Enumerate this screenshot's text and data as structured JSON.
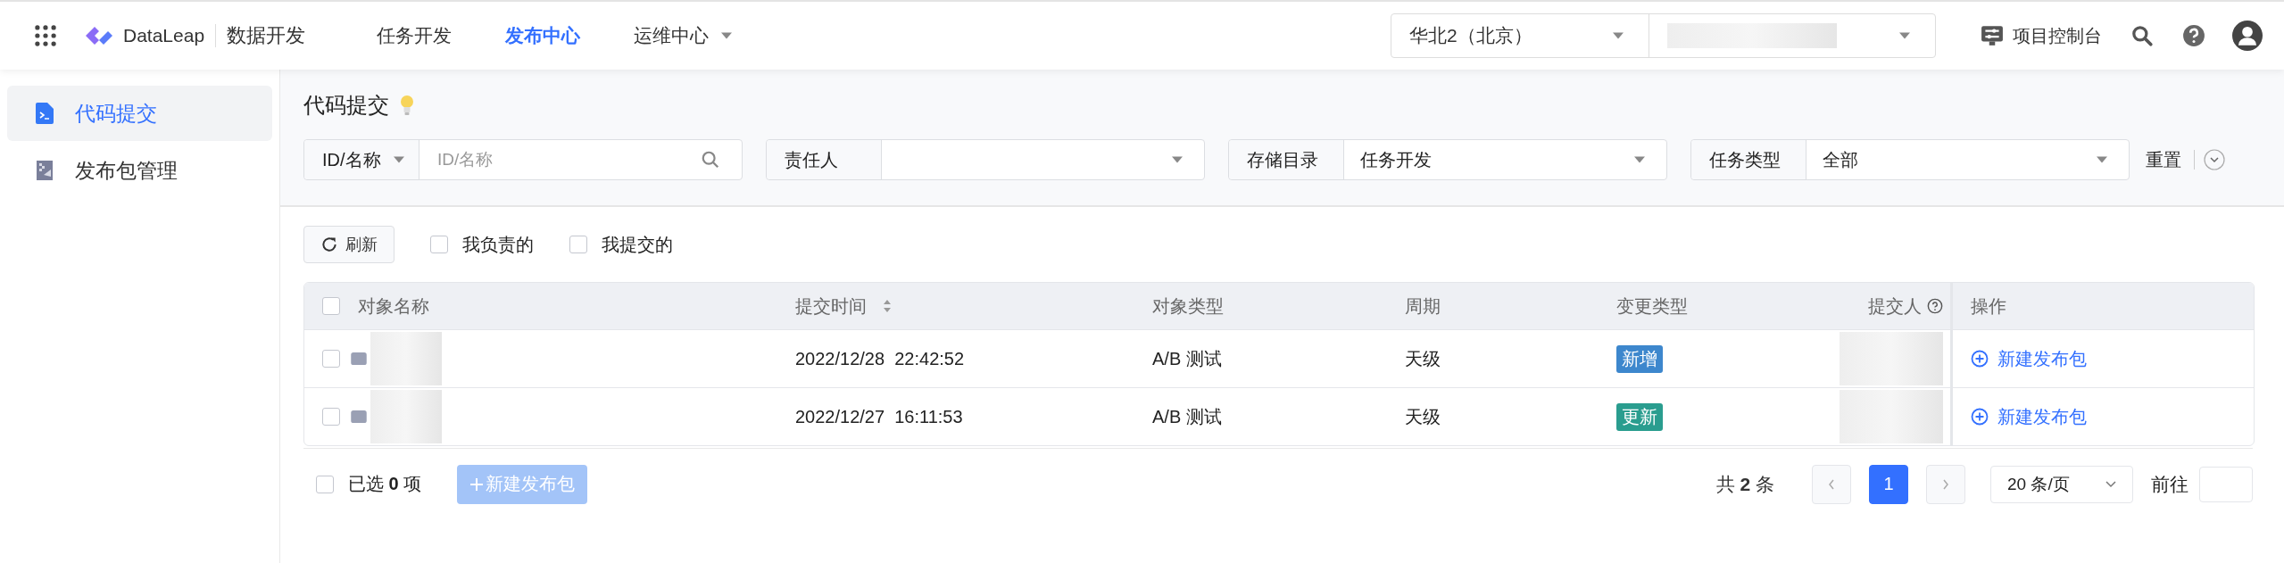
{
  "header": {
    "brand": "DataLeap",
    "product": "数据开发",
    "nav": [
      {
        "label": "任务开发",
        "selected": false,
        "dropdown": false
      },
      {
        "label": "发布中心",
        "selected": true,
        "dropdown": false
      },
      {
        "label": "运维中心",
        "selected": false,
        "dropdown": true
      }
    ],
    "region": "华北2（北京）",
    "console": "项目控制台"
  },
  "sidebar": {
    "items": [
      {
        "label": "代码提交",
        "selected": true,
        "kind": "code"
      },
      {
        "label": "发布包管理",
        "selected": false,
        "kind": "package"
      }
    ]
  },
  "page_title": "代码提交",
  "filters": [
    {
      "kind": "search",
      "label": "ID/名称",
      "placeholder": "ID/名称"
    },
    {
      "kind": "select",
      "label": "责任人"
    },
    {
      "kind": "select",
      "label": "存储目录",
      "value": "任务开发"
    },
    {
      "kind": "select",
      "label": "任务类型",
      "value": "全部"
    }
  ],
  "reset": "重置",
  "refresh": "刷新",
  "quick_filters": [
    {
      "label": "我负责的",
      "checked": false
    },
    {
      "label": "我提交的",
      "checked": false
    }
  ],
  "table": {
    "select_all_checked": false,
    "columns": [
      {
        "label": "对象名称",
        "kind": "plain"
      },
      {
        "label": "提交时间",
        "kind": "sortable"
      },
      {
        "label": "对象类型",
        "kind": "plain"
      },
      {
        "label": "周期",
        "kind": "plain"
      },
      {
        "label": "变更类型",
        "kind": "plain"
      },
      {
        "label": "提交人",
        "kind": "help"
      },
      {
        "label": "操作",
        "kind": "plain"
      }
    ],
    "rows": [
      {
        "checked": false,
        "time": "2022/12/28  22:42:52",
        "type": "A/B 测试",
        "period": "天级",
        "change": "新增",
        "color": "#3d87cd",
        "action": "新建发布包"
      },
      {
        "checked": false,
        "time": "2022/12/27  16:11:53",
        "type": "A/B 测试",
        "period": "天级",
        "change": "更新",
        "color": "#2a9d8f",
        "action": "新建发布包"
      }
    ]
  },
  "footer": {
    "select_all_checked": false,
    "selected_text": "已选 **0** 项",
    "new_button": "新建发布包",
    "new_button_disabled": true,
    "total": "共 **2** 条",
    "pages": [
      {
        "label": "1",
        "selected": true
      }
    ],
    "page_size": "20 条/页",
    "goto": "前往"
  }
}
